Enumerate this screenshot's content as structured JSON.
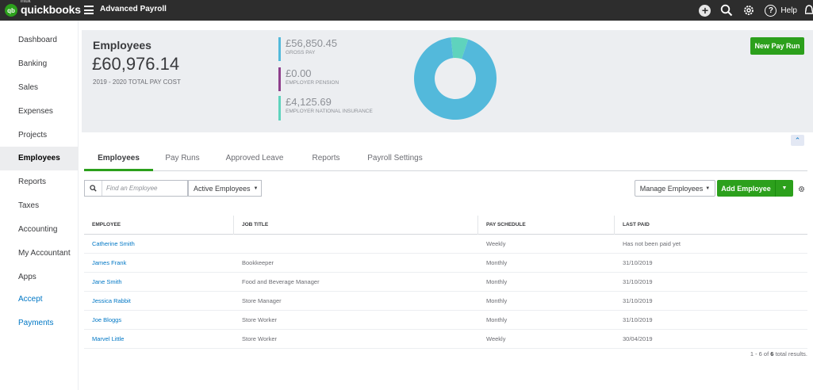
{
  "app": {
    "logo_mark": "qb",
    "logo_intuit": "intuit",
    "logo_name": "quickbooks",
    "title": "Advanced Payroll",
    "help_label": "Help"
  },
  "top_icons": [
    "plus-icon",
    "search-icon",
    "gear-icon",
    "help-icon"
  ],
  "sidebar": {
    "items": [
      {
        "label": "Dashboard"
      },
      {
        "label": "Banking"
      },
      {
        "label": "Sales"
      },
      {
        "label": "Expenses"
      },
      {
        "label": "Projects"
      },
      {
        "label": "Employees"
      },
      {
        "label": "Reports"
      },
      {
        "label": "Taxes"
      },
      {
        "label": "Accounting"
      },
      {
        "label": "My Accountant"
      },
      {
        "label": "Apps"
      },
      {
        "label": "Accept Payments"
      }
    ],
    "active": "Employees"
  },
  "summary": {
    "title": "Employees",
    "total": "£60,976.14",
    "subtitle": "2019 - 2020 TOTAL PAY COST",
    "stats": [
      {
        "value": "£56,850.45",
        "label": "GROSS PAY",
        "color": "#53b9db"
      },
      {
        "value": "£0.00",
        "label": "EMPLOYER PENSION",
        "color": "#8e3f8c"
      },
      {
        "value": "£4,125.69",
        "label": "EMPLOYER NATIONAL INSURANCE",
        "color": "#5fd3bd"
      }
    ],
    "new_pay_run": "New Pay Run"
  },
  "chart_data": {
    "type": "pie",
    "donut": true,
    "labels": [
      "Gross Pay",
      "Employer Pension",
      "Employer National Insurance"
    ],
    "values": [
      56850.45,
      0.0,
      4125.69
    ],
    "colors": [
      "#53b9db",
      "#8e3f8c",
      "#5fd3bd"
    ]
  },
  "tabs": [
    {
      "label": "Employees"
    },
    {
      "label": "Pay Runs"
    },
    {
      "label": "Approved Leave"
    },
    {
      "label": "Reports"
    },
    {
      "label": "Payroll Settings"
    }
  ],
  "active_tab": "Employees",
  "filters": {
    "search_placeholder": "Find an Employee",
    "status_select": "Active Employees"
  },
  "actions": {
    "manage": "Manage Employees",
    "add": "Add Employee"
  },
  "table": {
    "columns": [
      "EMPLOYEE",
      "JOB TITLE",
      "PAY SCHEDULE",
      "LAST PAID"
    ],
    "rows": [
      {
        "employee": "Catherine Smith",
        "job_title": "",
        "pay_schedule": "Weekly",
        "last_paid": "Has not been paid yet"
      },
      {
        "employee": "James Frank",
        "job_title": "Bookkeeper",
        "pay_schedule": "Monthly",
        "last_paid": "31/10/2019"
      },
      {
        "employee": "Jane Smith",
        "job_title": "Food and Beverage Manager",
        "pay_schedule": "Monthly",
        "last_paid": "31/10/2019"
      },
      {
        "employee": "Jessica Rabbit",
        "job_title": "Store Manager",
        "pay_schedule": "Monthly",
        "last_paid": "31/10/2019"
      },
      {
        "employee": "Joe Bloggs",
        "job_title": "Store Worker",
        "pay_schedule": "Monthly",
        "last_paid": "31/10/2019"
      },
      {
        "employee": "Marvel Little",
        "job_title": "Store Worker",
        "pay_schedule": "Weekly",
        "last_paid": "30/04/2019"
      }
    ]
  },
  "pagination": {
    "range": "1 - 6 of",
    "total": "6",
    "suffix": "total results."
  }
}
